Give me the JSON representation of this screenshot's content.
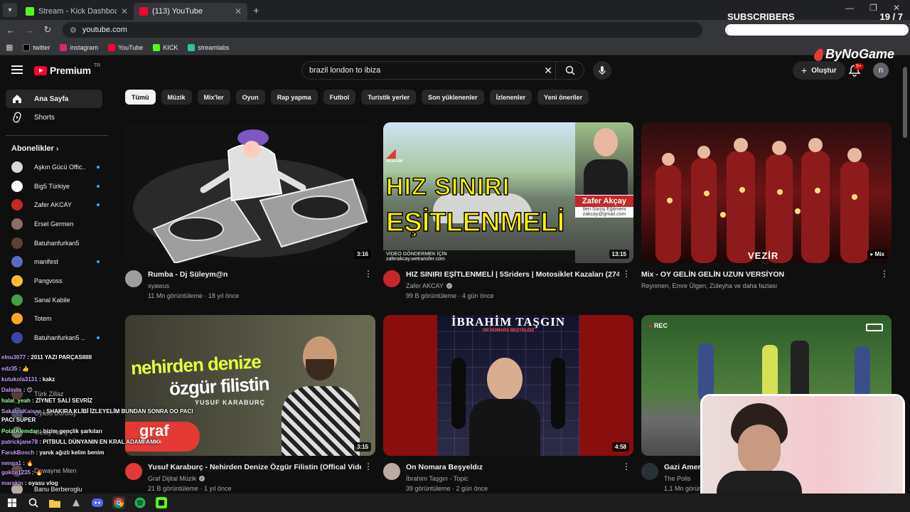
{
  "browser": {
    "tabs": [
      {
        "title": "Stream - Kick Dashboard",
        "favicon_color": "#53fc18",
        "active": false
      },
      {
        "title": "(113) YouTube",
        "favicon_color": "#ff0033",
        "active": true
      }
    ],
    "url": "youtube.com",
    "bookmarks": [
      {
        "label": "twitter",
        "icon_color": "#000000"
      },
      {
        "label": "instagram",
        "icon_color": "#d62976"
      },
      {
        "label": "YouTube",
        "icon_color": "#ff0033"
      },
      {
        "label": "KICK",
        "icon_color": "#53fc18"
      },
      {
        "label": "streamlabs",
        "icon_color": "#31c3a2"
      }
    ]
  },
  "header": {
    "logo_text": "Premium",
    "logo_suffix": "TR",
    "search_query": "brazil london to ibiza",
    "create_label": "Oluştur",
    "notif_badge": "9+",
    "avatar_letter": "n"
  },
  "chips": [
    "Tümü",
    "Müzik",
    "Mix'ler",
    "Oyun",
    "Rap yapma",
    "Futbol",
    "Turistik yerler",
    "Son yüklenenler",
    "İzlenenler",
    "Yeni öneriler"
  ],
  "sidebar": {
    "home": "Ana Sayfa",
    "shorts": "Shorts",
    "subs_heading": "Abonelikler",
    "subscriptions": [
      {
        "name": "Aşkın Gücü Offic...",
        "color": "#d9d9d9"
      },
      {
        "name": "Big5 Türkiye",
        "color": "#ffffff"
      },
      {
        "name": "Zafer AKCAY",
        "color": "#c62828"
      },
      {
        "name": "Ersel Germen",
        "color": "#8d6e63"
      },
      {
        "name": "Batuhanfurkan5",
        "color": "#5d4037"
      },
      {
        "name": "manifest",
        "color": "#5c6bc0"
      },
      {
        "name": "Pangvoss",
        "color": "#fbc02d"
      },
      {
        "name": "Sanal Kabile",
        "color": "#43a047"
      },
      {
        "name": "Totem",
        "color": "#f9a825"
      },
      {
        "name": "Batuhanfurkan5 ...",
        "color": "#3949ab"
      }
    ],
    "more_items": [
      "Türk Zillaz",
      "Oyasu Duruluy",
      "Metay Nuny",
      "Dawayne Mien",
      "Banu Berberoglu"
    ]
  },
  "videos": [
    {
      "title": "Rumba - Dj Süleym@n",
      "channel": "syawus",
      "stats": "11 Mn görüntüleme · 18 yıl önce",
      "duration": "3:16",
      "verified": false
    },
    {
      "title": "HIZ SINIRI EŞİTLENMELİ | 5Sriders | Motosiklet Kazaları (274)",
      "channel": "Zafer AKCAY",
      "stats": "99 B görüntüleme · 4 gün önce",
      "duration": "13:15",
      "verified": true,
      "thumb_line1": "HIZ SINIRI",
      "thumb_line2": "EŞİTLENMELİ",
      "thumb_name": "Zafer Akçay",
      "thumb_role": "İleri Sürüş Eğitmeni",
      "thumb_mail": "zakcay@gmail.com",
      "thumb_footer1": "VİDEO GÖNDERMEK İÇİN",
      "thumb_footer2": "zaferakcay.wetransfer.com",
      "thumb_brand": "AKADEMİ"
    },
    {
      "title": "Mix - OY GELİN GELİN UZUN VERSİYON",
      "channel": "Reynmen, Emre Ülgen, Züleyha ve daha fazlası",
      "stats": "",
      "duration": "Mix",
      "verified": false,
      "thumb_text": "VEZİR"
    },
    {
      "title": "Yusuf Karaburç - Nehirden Denize Özgür Filistin (Offical Video)",
      "channel": "Graf Dijital Müzik",
      "stats": "21 B görüntüleme · 1 yıl önce",
      "duration": "3:15",
      "verified": true,
      "thumb_line1": "nehirden denize",
      "thumb_line2": "özgür filistin",
      "thumb_artist": "YUSUF KARABURÇ",
      "thumb_logo": "graf",
      "thumb_logo_sub": "dijital müzik"
    },
    {
      "title": "On Nomara Beşyeldız",
      "channel": "İbrahim Taşgın - Topic",
      "stats": "39 görüntüleme · 2 gün önce",
      "duration": "4:58",
      "verified": false,
      "thumb_line1": "İBRAHİM TAŞGIN",
      "thumb_line2": "ON NOMARA BEŞYELDIZ"
    },
    {
      "title": "Gazi Amer",
      "channel": "The Polis",
      "stats": "1,1 Mn görün",
      "duration": "",
      "verified": false,
      "thumb_rec": "REC"
    }
  ],
  "overlay": {
    "subs_label": "SUBSCRIBERS",
    "subs_count": "19 / 7",
    "subs_progress": 1.0,
    "brand": "ByNoGame"
  },
  "chat": [
    {
      "user": "elnu3077",
      "msg": ": 2011 YAZI PARÇASIIIIII"
    },
    {
      "user": "edz35",
      "msg": ": 👍"
    },
    {
      "user": "kutukola3131",
      "msg": ": kakz"
    },
    {
      "user": "Dalinile",
      "msg": ": 😊"
    },
    {
      "user": "halal_yeah",
      "msg": ": ZİYNET SALİ SEVRİZ",
      "green": true
    },
    {
      "user": "SakalpaKaisae",
      "msg": ": SHAKIRA KLİBİ İZLEYELİM BUNDAN SONRA OO PACI"
    },
    {
      "user": "",
      "msg": "PACI SÜPER"
    },
    {
      "user": "PolatAlemdar",
      "msg": ": bizim gençlik şarkıları",
      "green": true
    },
    {
      "user": "patrickjane78",
      "msg": ": PITBULL DÜNYANIN EN KRAL ADAMI AMK"
    },
    {
      "user": "FarukBosch",
      "msg": ": yanık ağızlı kelim benim"
    },
    {
      "user": "nenga1",
      "msg": ": 🔥"
    },
    {
      "user": "gokce1235",
      "msg": ": 🔥"
    },
    {
      "user": "marakin",
      "msg": ": oyasu vlog"
    }
  ],
  "taskbar": [
    {
      "icon": "windows-icon",
      "color": "#ffffff"
    },
    {
      "icon": "search-icon",
      "color": "#ffffff"
    },
    {
      "icon": "folder-icon",
      "color": "#f4c842"
    },
    {
      "icon": "app-icon",
      "color": "#bbbbbb"
    },
    {
      "icon": "discord-icon",
      "color": "#5865f2"
    },
    {
      "icon": "chrome-icon",
      "color": "#4285f4"
    },
    {
      "icon": "spotify-icon",
      "color": "#1db954"
    },
    {
      "icon": "kick-app-icon",
      "color": "#53fc18"
    }
  ]
}
